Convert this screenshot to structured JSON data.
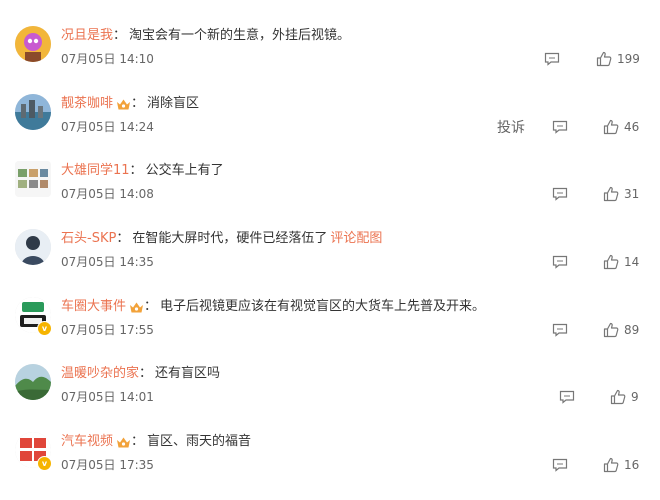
{
  "comments": [
    {
      "username": "况且是我",
      "vip": false,
      "verified": false,
      "colon": "：",
      "text": "淘宝会有一个新的生意，外挂后视镜。",
      "link": "",
      "time": "07月05日 14:10",
      "likes": "199",
      "report": ""
    },
    {
      "username": "靓茶咖啡",
      "vip": true,
      "verified": false,
      "colon": "：",
      "text": "消除盲区",
      "link": "",
      "time": "07月05日 14:24",
      "likes": "46",
      "report": "投诉"
    },
    {
      "username": "大雄同学11",
      "vip": false,
      "verified": false,
      "colon": "：",
      "text": "公交车上有了",
      "link": "",
      "time": "07月05日 14:08",
      "likes": "31",
      "report": ""
    },
    {
      "username": "石头-SKP",
      "vip": false,
      "verified": false,
      "colon": "：",
      "text": "在智能大屏时代，硬件已经落伍了",
      "link": "评论配图",
      "time": "07月05日 14:35",
      "likes": "14",
      "report": ""
    },
    {
      "username": "车圈大事件",
      "vip": true,
      "verified": true,
      "colon": "：",
      "text": "电子后视镜更应该在有视觉盲区的大货车上先普及开来。",
      "link": "",
      "time": "07月05日 17:55",
      "likes": "89",
      "report": ""
    },
    {
      "username": "温暖吵杂的家",
      "vip": false,
      "verified": false,
      "colon": "：",
      "text": "还有盲区吗",
      "link": "",
      "time": "07月05日 14:01",
      "likes": "9",
      "report": ""
    },
    {
      "username": "汽车视频",
      "vip": true,
      "verified": true,
      "colon": "：",
      "text": "盲区、雨天的福音",
      "link": "",
      "time": "07月05日 17:35",
      "likes": "16",
      "report": ""
    }
  ],
  "colors": {
    "username": "#eb7350",
    "text": "#333333",
    "meta": "#666666",
    "vip_badge": "#f2a23a",
    "verified_badge": "#f6b400"
  },
  "icons": {
    "reply": "comment-bubble-icon",
    "like": "thumbs-up-icon",
    "vip": "vip-crown-icon",
    "verified": "verified-v-icon"
  }
}
